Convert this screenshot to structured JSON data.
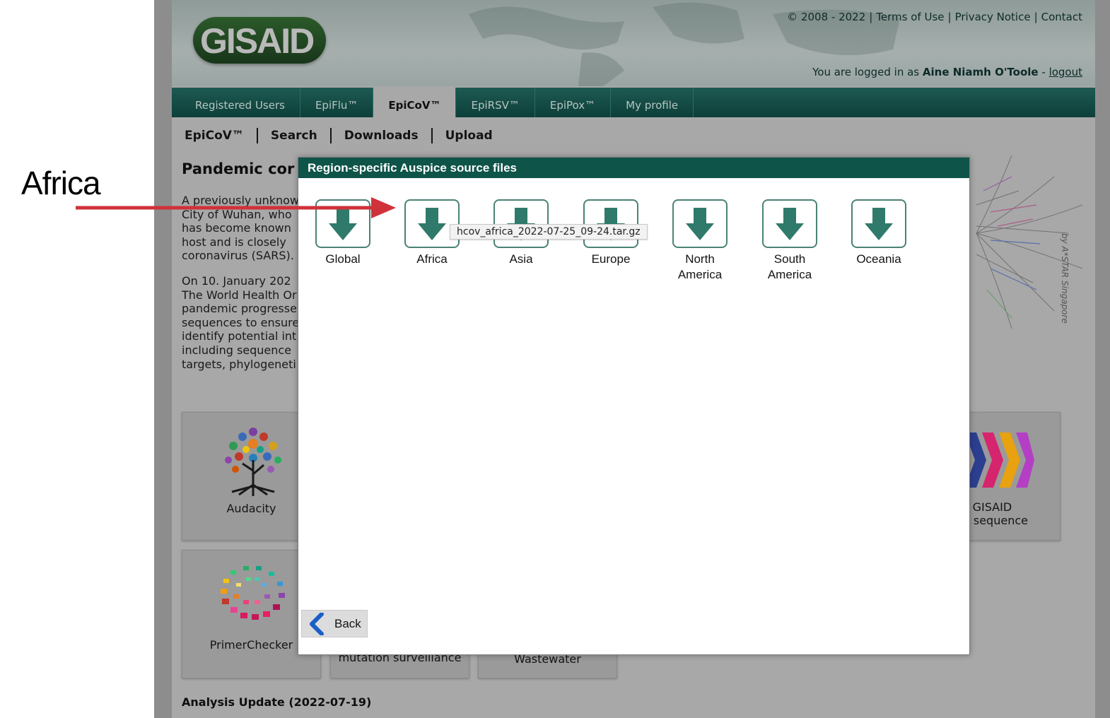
{
  "annotation": {
    "label": "Africa"
  },
  "header": {
    "logo_text": "GISAID",
    "copyright": "© 2008 - 2022",
    "links": [
      "Terms of Use",
      "Privacy Notice",
      "Contact"
    ],
    "login_prefix": "You are logged in as",
    "user_name": "Aine Niamh O'Toole",
    "login_sep": "-",
    "logout": "logout"
  },
  "nav": {
    "tabs": [
      {
        "label": "Registered Users",
        "active": false
      },
      {
        "label": "EpiFlu™",
        "active": false
      },
      {
        "label": "EpiCoV™",
        "active": true
      },
      {
        "label": "EpiRSV™",
        "active": false
      },
      {
        "label": "EpiPox™",
        "active": false
      },
      {
        "label": "My profile",
        "active": false
      }
    ]
  },
  "subnav": {
    "items": [
      "EpiCoV™",
      "Search",
      "Downloads",
      "Upload"
    ]
  },
  "background": {
    "pandemic_title": "Pandemic cor",
    "para1": [
      "A previously unknow",
      "City of Wuhan, who",
      "has become known",
      "host and is closely",
      "coronavirus (SARS)."
    ],
    "para2": [
      "On 10. January 202",
      "The World Health Or",
      "pandemic progresse",
      "sequences to ensure",
      "identify potential int",
      "including sequence",
      "targets, phylogeneti"
    ],
    "cards": {
      "audacity": "Audacity",
      "primer": "PrimerChecker",
      "mutation": "mutation surveillance",
      "wastewater": "Wastewater",
      "reference_line1": "cial GISAID",
      "reference_line2": "nce sequence"
    },
    "credit": "by A*STAR Singapore",
    "analysis_update": "Analysis Update (2022-07-19)"
  },
  "modal": {
    "title": "Region-specific Auspice source files",
    "regions": [
      {
        "label_line1": "Global",
        "label_line2": ""
      },
      {
        "label_line1": "Africa",
        "label_line2": ""
      },
      {
        "label_line1": "Asia",
        "label_line2": ""
      },
      {
        "label_line1": "Europe",
        "label_line2": ""
      },
      {
        "label_line1": "North",
        "label_line2": "America"
      },
      {
        "label_line1": "South",
        "label_line2": "America"
      },
      {
        "label_line1": "Oceania",
        "label_line2": ""
      }
    ],
    "tooltip": "hcov_africa_2022-07-25_09-24.tar.gz",
    "back_label": "Back"
  },
  "colors": {
    "teal_dark": "#0e5448",
    "button_border": "#4a8276",
    "arrow_fill": "#2f7a6a",
    "annotation_arrow": "#d0323a"
  }
}
